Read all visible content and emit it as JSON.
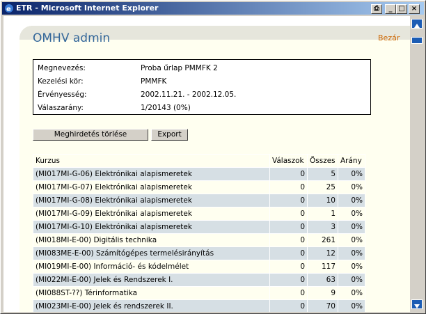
{
  "window": {
    "title": "ETR - Microsoft Internet Explorer"
  },
  "page": {
    "title": "OMHV admin",
    "close_label": "Bezár"
  },
  "info": [
    {
      "label": "Megnevezés:",
      "value": "Proba űrlap PMMFK 2"
    },
    {
      "label": "Kezelési kör:",
      "value": "PMMFK"
    },
    {
      "label": "Érvényesség:",
      "value": "2002.11.21. - 2002.12.05."
    },
    {
      "label": "Válaszarány:",
      "value": "1/20143 (0%)"
    }
  ],
  "buttons": {
    "delete_label": "Meghirdetés törlése",
    "export_label": "Export"
  },
  "table": {
    "headers": [
      "Kurzus",
      "Válaszok",
      "Összes",
      "Arány"
    ],
    "rows": [
      [
        "(MI017MI-G-06) Elektrónikai alapismeretek",
        "0",
        "5",
        "0%"
      ],
      [
        "(MI017MI-G-07) Elektrónikai alapismeretek",
        "0",
        "25",
        "0%"
      ],
      [
        "(MI017MI-G-08) Elektrónikai alapismeretek",
        "0",
        "10",
        "0%"
      ],
      [
        "(MI017MI-G-09) Elektrónikai alapismeretek",
        "0",
        "1",
        "0%"
      ],
      [
        "(MI017MI-G-10) Elektrónikai alapismeretek",
        "0",
        "3",
        "0%"
      ],
      [
        "(MI018MI-E-00) Digitális technika",
        "0",
        "261",
        "0%"
      ],
      [
        "(MI083ME-E-00) Számítógépes termelésirányítás",
        "0",
        "12",
        "0%"
      ],
      [
        "(MI019MI-E-00) Információ- és kódelmélet",
        "0",
        "117",
        "0%"
      ],
      [
        "(MI022MI-E-00) Jelek és Rendszerek I.",
        "0",
        "63",
        "0%"
      ],
      [
        "(MI088ST-??) Térinformatika",
        "0",
        "9",
        "0%"
      ],
      [
        "(MI023MI-E-00) Jelek és rendszerek II.",
        "0",
        "70",
        "0%"
      ]
    ]
  }
}
